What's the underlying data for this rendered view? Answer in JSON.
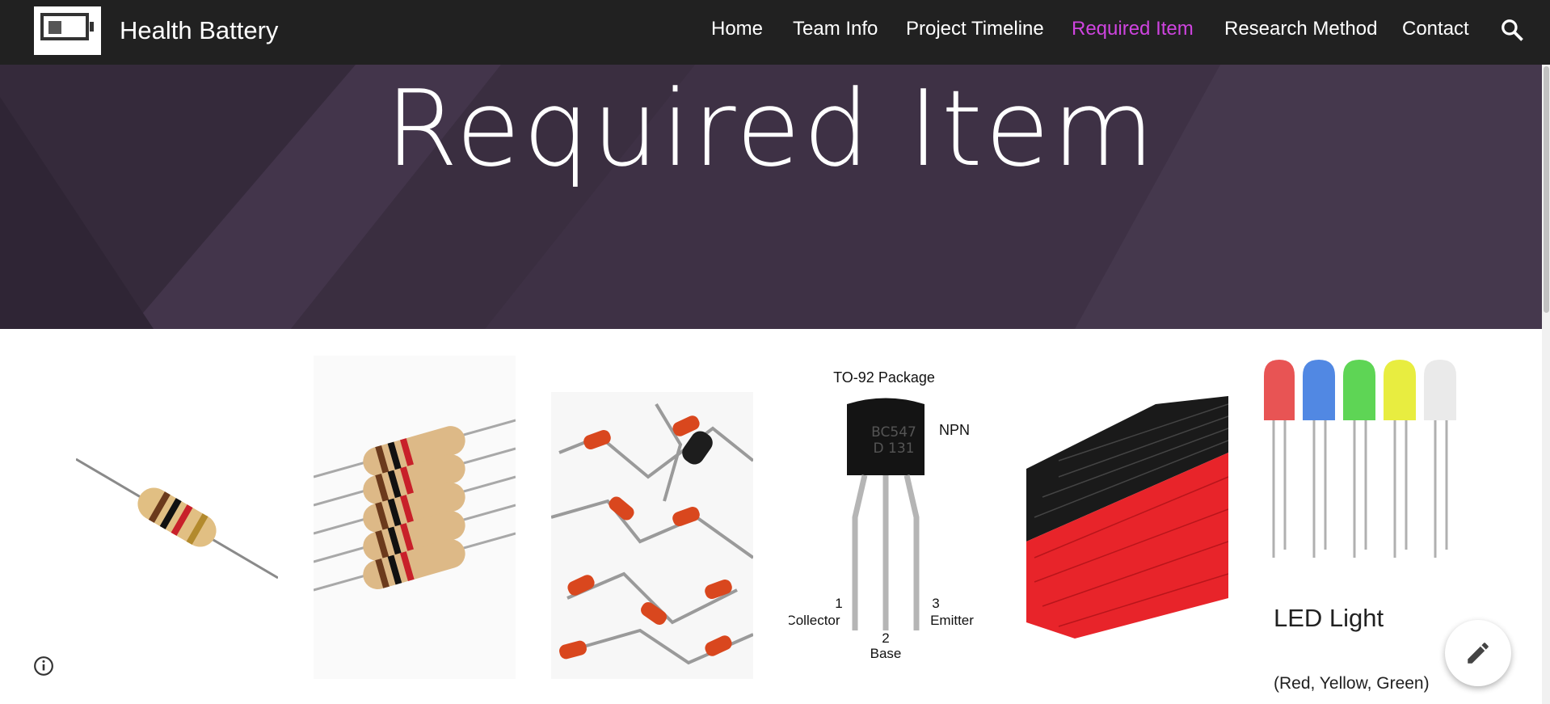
{
  "site": {
    "title": "Health Battery",
    "logo_icon": "battery-logo-icon"
  },
  "nav": {
    "items": [
      {
        "label": "Home",
        "active": false
      },
      {
        "label": "Team Info",
        "active": false
      },
      {
        "label": "Project Timeline",
        "active": false
      },
      {
        "label": "Required Item",
        "active": true
      },
      {
        "label": "Research Method",
        "active": false
      },
      {
        "label": "Contact",
        "active": false
      }
    ],
    "search_icon": "search-icon",
    "active_color": "#cf44e0"
  },
  "hero": {
    "title": "Required Item",
    "background_color": "#3e3145"
  },
  "gallery": {
    "items": [
      {
        "icon": "resistor-image"
      },
      {
        "icon": "resistors-group-image"
      },
      {
        "icon": "diodes-image"
      },
      {
        "icon": "transistor-diagram-image",
        "labels": {
          "package": "TO-92 Package",
          "marking_line1": "BC547",
          "marking_line2": "D 131",
          "type": "NPN",
          "pin1_num": "1",
          "pin1_name": "Collector",
          "pin2_num": "2",
          "pin2_name": "Base",
          "pin3_num": "3",
          "pin3_name": "Emitter"
        }
      },
      {
        "icon": "wires-image"
      },
      {
        "icon": "led-lights-image",
        "title": "LED Light",
        "subtitle": "(Red, Yellow, Green)"
      }
    ]
  },
  "floating": {
    "info_icon": "info-icon",
    "edit_icon": "pencil-icon"
  }
}
